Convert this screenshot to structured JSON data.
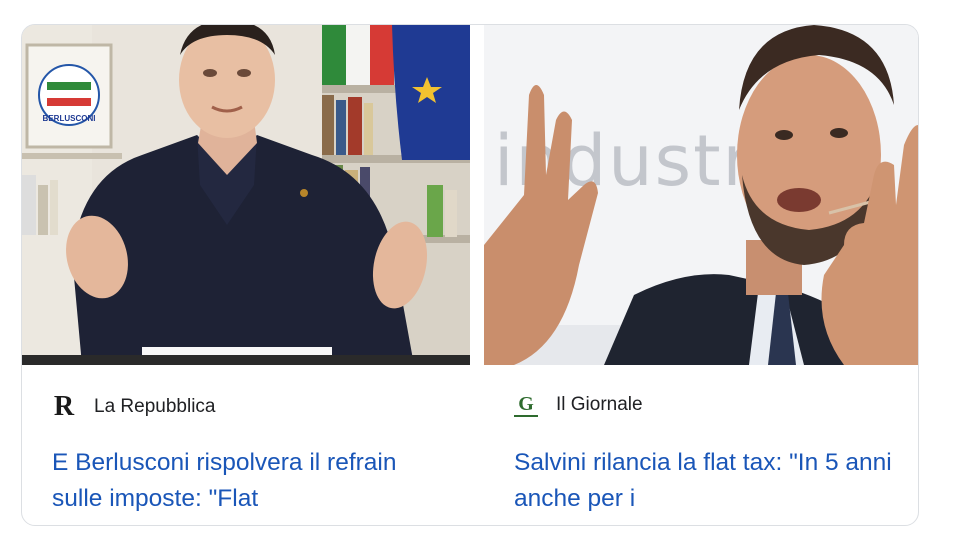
{
  "articles": [
    {
      "source": "La Repubblica",
      "logo_letter": "R",
      "headline": "E Berlusconi rispolvera il refrain sulle imposte: \"Flat",
      "image_alt": "Silvio Berlusconi speaking at a desk with flags behind"
    },
    {
      "source": "Il Giornale",
      "logo_letter": "G",
      "headline": "Salvini rilancia la flat tax: \"In 5 anni anche per i",
      "image_alt": "Matteo Salvini gesturing with hands in front of a backdrop",
      "backdrop_text": "industr"
    }
  ],
  "badge_text": "BERLUSCONI",
  "colors": {
    "headline_link": "#1a56b8",
    "source_text": "#202124",
    "border": "#dcdfe3",
    "eu_blue": "#1f3a93",
    "giornale_green": "#2e6b2e"
  }
}
